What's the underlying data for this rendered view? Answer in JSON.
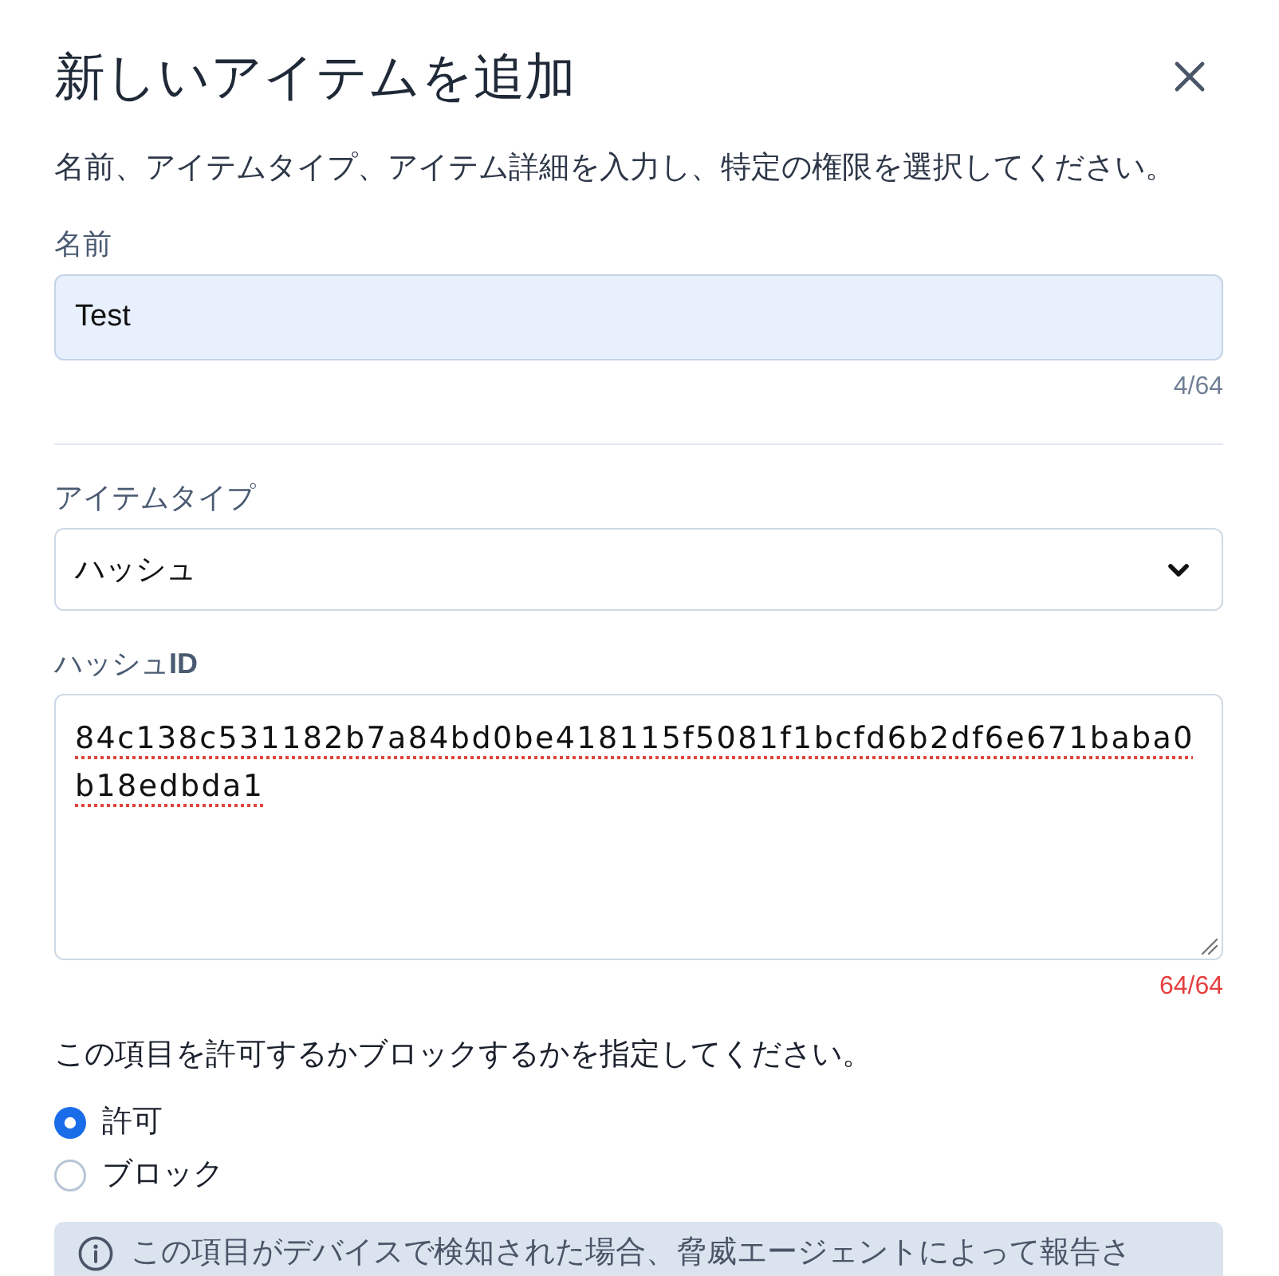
{
  "dialog": {
    "title": "新しいアイテムを追加",
    "description": "名前、アイテムタイプ、アイテム詳細を入力し、特定の権限を選択してください。"
  },
  "fields": [
    {
      "kind": "input",
      "label": "名前",
      "value": "Test",
      "autofilled": true,
      "counter": "4/64",
      "over_limit": false
    },
    {
      "kind": "select",
      "label": "アイテムタイプ",
      "value": "ハッシュ"
    },
    {
      "kind": "textarea",
      "label": "ハッシュ**ID**",
      "value": "84c138c531182b7a84bd0be418115f5081f1bcfd6b2df6e671baba0b18edbda1",
      "spelling_error": true,
      "counter": "64/64",
      "over_limit": true
    }
  ],
  "permission": {
    "question": "この項目を許可するかブロックするかを指定してください。",
    "options": [
      {
        "label": "許可",
        "selected": true
      },
      {
        "label": "ブロック",
        "selected": false
      }
    ]
  },
  "notice": {
    "text": "この項目がデバイスで検知された場合、脅威エージェントによって報告さ"
  }
}
